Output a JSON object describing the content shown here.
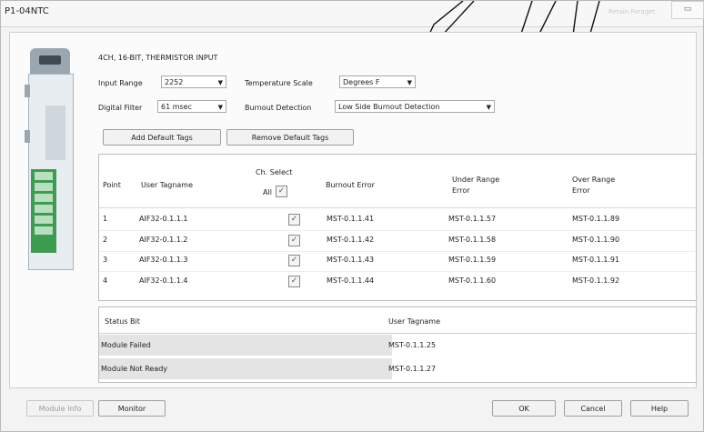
{
  "window": {
    "title": "P1-04NTC",
    "faint_title": "Retain Foraget"
  },
  "module": {
    "description": "4CH, 16-BIT, THERMISTOR INPUT",
    "input_range": {
      "label": "Input Range",
      "value": "2252"
    },
    "temperature_scale": {
      "label": "Temperature Scale",
      "value": "Degrees F"
    },
    "digital_filter": {
      "label": "Digital Filter",
      "value": "61 msec"
    },
    "burnout_detection": {
      "label": "Burnout Detection",
      "value": "Low Side Burnout Detection"
    }
  },
  "buttons": {
    "add_default_tags": "Add Default Tags",
    "remove_default_tags": "Remove Default Tags",
    "module_info": "Module Info",
    "monitor": "Monitor",
    "ok": "OK",
    "cancel": "Cancel",
    "help": "Help"
  },
  "channel_table": {
    "headers": {
      "point": "Point",
      "user_tagname": "User Tagname",
      "ch_select": "Ch. Select",
      "all": "All",
      "burnout_error": "Burnout Error",
      "under_range_error_1": "Under Range",
      "under_range_error_2": "Error",
      "over_range_error_1": "Over Range",
      "over_range_error_2": "Error"
    },
    "rows": [
      {
        "point": "1",
        "tagname": "AIF32-0.1.1.1",
        "selected": "✓",
        "burnout": "MST-0.1.1.41",
        "under": "MST-0.1.1.57",
        "over": "MST-0.1.1.89"
      },
      {
        "point": "2",
        "tagname": "AIF32-0.1.1.2",
        "selected": "✓",
        "burnout": "MST-0.1.1.42",
        "under": "MST-0.1.1.58",
        "over": "MST-0.1.1.90"
      },
      {
        "point": "3",
        "tagname": "AIF32-0.1.1.3",
        "selected": "✓",
        "burnout": "MST-0.1.1.43",
        "under": "MST-0.1.1.59",
        "over": "MST-0.1.1.91"
      },
      {
        "point": "4",
        "tagname": "AIF32-0.1.1.4",
        "selected": "✓",
        "burnout": "MST-0.1.1.44",
        "under": "MST-0.1.1.60",
        "over": "MST-0.1.1.92"
      }
    ]
  },
  "status_table": {
    "headers": {
      "status_bit": "Status Bit",
      "user_tagname": "User Tagname"
    },
    "rows": [
      {
        "name": "Module Failed",
        "tag": "MST-0.1.1.25"
      },
      {
        "name": "Module Not Ready",
        "tag": "MST-0.1.1.27"
      }
    ]
  },
  "colors": {
    "terminal_green": "#3e9b52",
    "window_bg": "#f3f3f3",
    "annotation_line": "#111111"
  }
}
